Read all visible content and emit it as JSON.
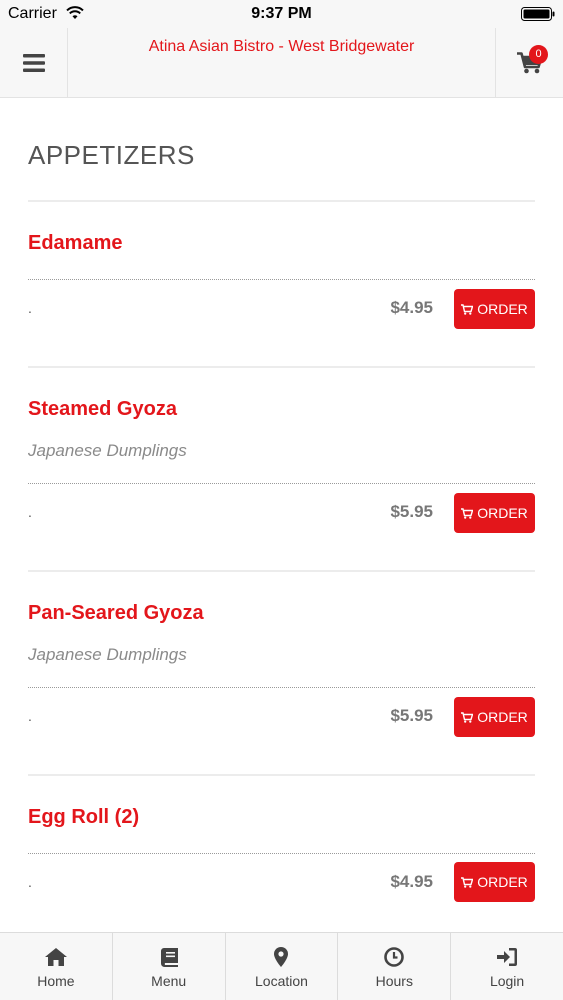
{
  "status_bar": {
    "carrier": "Carrier",
    "time": "9:37 PM"
  },
  "header": {
    "title": "Atina Asian Bistro - West Bridgewater",
    "cart_count": "0",
    "menu_icon": "hamburger-icon",
    "cart_icon": "cart-icon"
  },
  "section": {
    "title": "APPETIZERS"
  },
  "items": [
    {
      "name": "Edamame",
      "description": "",
      "dot": ".",
      "price": "$4.95",
      "order_label": "ORDER"
    },
    {
      "name": "Steamed Gyoza",
      "description": "Japanese Dumplings",
      "dot": ".",
      "price": "$5.95",
      "order_label": "ORDER"
    },
    {
      "name": "Pan-Seared Gyoza",
      "description": "Japanese Dumplings",
      "dot": ".",
      "price": "$5.95",
      "order_label": "ORDER"
    },
    {
      "name": "Egg Roll (2)",
      "description": "",
      "dot": ".",
      "price": "$4.95",
      "order_label": "ORDER"
    }
  ],
  "bottom_nav": [
    {
      "label": "Home",
      "icon": "home-icon"
    },
    {
      "label": "Menu",
      "icon": "book-icon"
    },
    {
      "label": "Location",
      "icon": "map-pin-icon"
    },
    {
      "label": "Hours",
      "icon": "clock-icon"
    },
    {
      "label": "Login",
      "icon": "login-icon"
    }
  ],
  "colors": {
    "accent": "#e3161b",
    "background": "#ffffff",
    "bar": "#f7f7f7"
  }
}
